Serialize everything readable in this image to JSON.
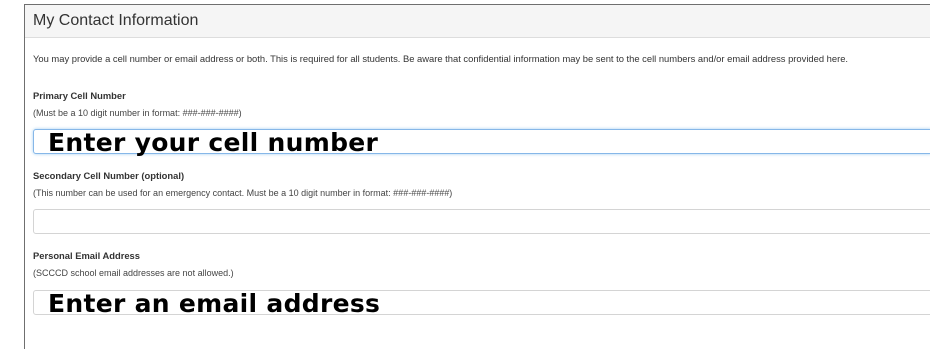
{
  "panel": {
    "title": "My Contact Information",
    "intro": "You may provide a cell number or email address or both. This is required for all students. Be aware that confidential information may be sent to the cell numbers and/or email address provided here."
  },
  "fields": {
    "primary_cell": {
      "label": "Primary Cell Number",
      "help": "(Must be a 10 digit number in format: ###-###-####)",
      "value": "",
      "overlay": "Enter your cell number"
    },
    "secondary_cell": {
      "label": "Secondary Cell Number (optional)",
      "help": "(This number can be used for an emergency contact. Must be a 10 digit number in format: ###-###-####)",
      "value": ""
    },
    "personal_email": {
      "label": "Personal Email Address",
      "help": "(SCCCD school email addresses are not allowed.)",
      "value": "",
      "overlay": "Enter an email address"
    }
  }
}
